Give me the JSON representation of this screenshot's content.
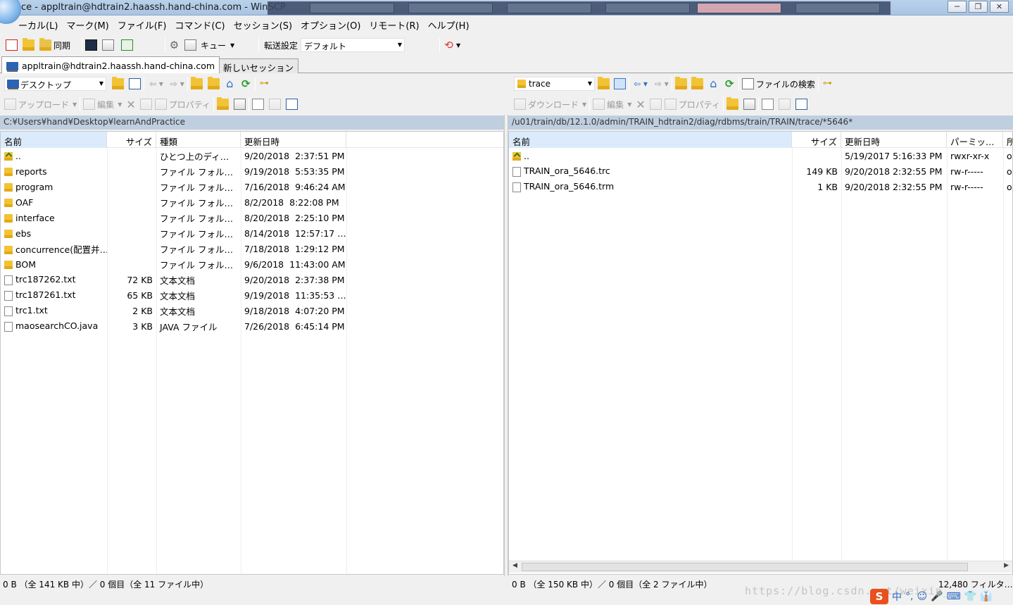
{
  "window": {
    "title": "ace - appltrain@hdtrain2.haassh.hand-china.com - WinSCP",
    "controls": [
      "─",
      "❐",
      "✕"
    ]
  },
  "menu": [
    "ーカル(L)",
    "マーク(M)",
    "ファイル(F)",
    "コマンド(C)",
    "セッション(S)",
    "オプション(O)",
    "リモート(R)",
    "ヘルプ(H)"
  ],
  "toolbar": {
    "sync_label": "同期",
    "queue_label": "キュー",
    "transfer_label": "転送設定",
    "transfer_value": "デフォルト"
  },
  "tabs": {
    "session": "appltrain@hdtrain2.haassh.hand-china.com",
    "new_session": "新しいセッション"
  },
  "left": {
    "location": "デスクトップ",
    "upload": "アップロード",
    "edit": "編集",
    "properties": "プロパティ",
    "path": "C:¥Users¥hand¥Desktop¥learnAndPractice",
    "columns": [
      "名前",
      "サイズ",
      "種類",
      "更新日時"
    ],
    "files": [
      {
        "icon": "up",
        "name": "..",
        "size": "",
        "type": "ひとつ上のディ…",
        "date": "9/20/2018",
        "time": "2:37:51 PM"
      },
      {
        "icon": "folder",
        "name": "reports",
        "size": "",
        "type": "ファイル フォル…",
        "date": "9/19/2018",
        "time": "5:53:35 PM"
      },
      {
        "icon": "folder",
        "name": "program",
        "size": "",
        "type": "ファイル フォル…",
        "date": "7/16/2018",
        "time": "9:46:24 AM"
      },
      {
        "icon": "folder",
        "name": "OAF",
        "size": "",
        "type": "ファイル フォル…",
        "date": "8/2/2018",
        "time": "8:22:08 PM"
      },
      {
        "icon": "folder",
        "name": "interface",
        "size": "",
        "type": "ファイル フォル…",
        "date": "8/20/2018",
        "time": "2:25:10 PM"
      },
      {
        "icon": "folder",
        "name": "ebs",
        "size": "",
        "type": "ファイル フォル…",
        "date": "8/14/2018",
        "time": "12:57:17 …"
      },
      {
        "icon": "folder",
        "name": "concurrence(配置并…",
        "size": "",
        "type": "ファイル フォル…",
        "date": "7/18/2018",
        "time": "1:29:12 PM"
      },
      {
        "icon": "folder",
        "name": "BOM",
        "size": "",
        "type": "ファイル フォル…",
        "date": "9/6/2018",
        "time": "11:43:00 AM"
      },
      {
        "icon": "doc",
        "name": "trc187262.txt",
        "size": "72 KB",
        "type": "文本文档",
        "date": "9/20/2018",
        "time": "2:37:38 PM"
      },
      {
        "icon": "doc",
        "name": "trc187261.txt",
        "size": "65 KB",
        "type": "文本文档",
        "date": "9/19/2018",
        "time": "11:35:53 …"
      },
      {
        "icon": "doc",
        "name": "trc1.txt",
        "size": "2 KB",
        "type": "文本文档",
        "date": "9/18/2018",
        "time": "4:07:20 PM"
      },
      {
        "icon": "doc",
        "name": "maosearchCO.java",
        "size": "3 KB",
        "type": "JAVA ファイル",
        "date": "7/26/2018",
        "time": "6:45:14 PM"
      }
    ],
    "status": "0 B （全 141 KB 中）／ 0 個目（全 11 ファイル中）"
  },
  "right": {
    "location": "trace",
    "download": "ダウンロード",
    "edit": "編集",
    "properties": "プロパティ",
    "find": "ファイルの検索",
    "path": "/u01/train/db/12.1.0/admin/TRAIN_hdtrain2/diag/rdbms/train/TRAIN/trace/*5646*",
    "columns": [
      "名前",
      "サイズ",
      "更新日時",
      "パーミッ…",
      "所"
    ],
    "files": [
      {
        "icon": "up",
        "name": "..",
        "size": "",
        "date": "5/19/2017 5:16:33 PM",
        "perm": "rwxr-xr-x",
        "own": "o"
      },
      {
        "icon": "doc",
        "name": "TRAIN_ora_5646.trc",
        "size": "149 KB",
        "date": "9/20/2018 2:32:55 PM",
        "perm": "rw-r-----",
        "own": "o"
      },
      {
        "icon": "doc",
        "name": "TRAIN_ora_5646.trm",
        "size": "1 KB",
        "date": "9/20/2018 2:32:55 PM",
        "perm": "rw-r-----",
        "own": "o"
      }
    ],
    "status": "0 B （全 150 KB 中）／ 0 個目（全 2 ファイル中）",
    "filter_status": "12,480 フィルタ…"
  },
  "watermark": "https://blog.csdn.net/weixin_",
  "tray": [
    "中",
    "°,",
    "☺",
    "🎤",
    "⌨",
    "👕",
    "👔"
  ],
  "colors": {
    "title_bar": "#b9d1ea",
    "path_bar": "#bfcfe0",
    "sorted_header": "#dcebfc"
  }
}
